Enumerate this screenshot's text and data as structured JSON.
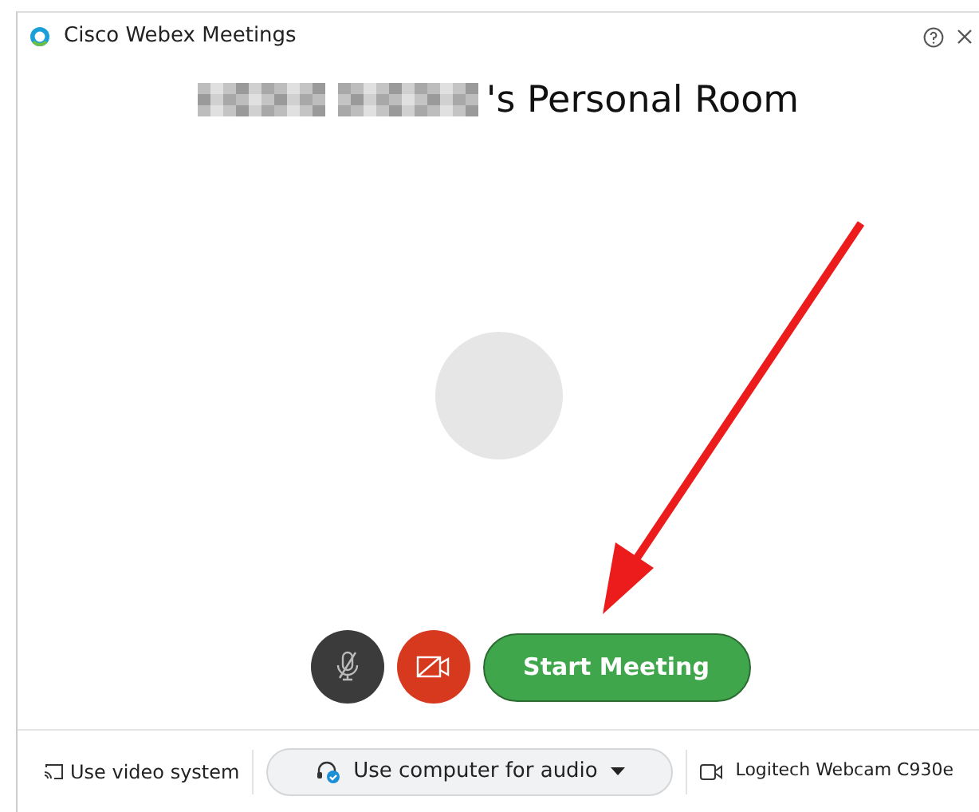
{
  "window": {
    "title": "Cisco Webex Meetings"
  },
  "heading": {
    "suffix": "'s Personal Room"
  },
  "controls": {
    "muted": true,
    "video_off": true,
    "start_button": "Start Meeting"
  },
  "footer": {
    "video_system": "Use video system",
    "audio": "Use computer for audio",
    "camera": "Logitech Webcam C930e"
  }
}
